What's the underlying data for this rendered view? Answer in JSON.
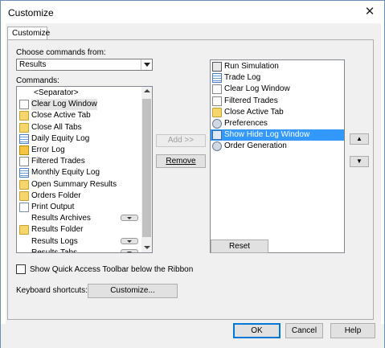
{
  "window": {
    "title": "Customize",
    "close_glyph": "✕"
  },
  "tab": {
    "label": "Customize"
  },
  "choose": {
    "label": "Choose commands from:",
    "value": "Results"
  },
  "commands": {
    "label": "Commands:",
    "items": [
      {
        "label": "<Separator>",
        "icon": "none"
      },
      {
        "label": "Clear Log Window",
        "icon": "clear-log-icon",
        "selected": true
      },
      {
        "label": "Close Active Tab",
        "icon": "folder-icon"
      },
      {
        "label": "Close All Tabs",
        "icon": "folder-icon"
      },
      {
        "label": "Daily Equity Log",
        "icon": "grid-icon"
      },
      {
        "label": "Error Log",
        "icon": "warning-icon"
      },
      {
        "label": "Filtered Trades",
        "icon": "filter-icon"
      },
      {
        "label": "Monthly Equity Log",
        "icon": "grid-icon"
      },
      {
        "label": "Open Summary Results",
        "icon": "open-icon"
      },
      {
        "label": "Orders Folder",
        "icon": "folder-icon"
      },
      {
        "label": "Print Output",
        "icon": "doc-icon"
      },
      {
        "label": "Results Archives",
        "icon": "none",
        "submenu": true
      },
      {
        "label": "Results Folder",
        "icon": "folder-icon"
      },
      {
        "label": "Results Logs",
        "icon": "none",
        "submenu": true
      },
      {
        "label": "Results Tabs",
        "icon": "none",
        "submenu": true
      }
    ]
  },
  "buttons": {
    "add": "Add >>",
    "remove": "Remove",
    "reset": "Reset",
    "move_up_glyph": "▲",
    "move_down_glyph": "▼",
    "customize": "Customize...",
    "ok": "OK",
    "cancel": "Cancel",
    "help": "Help"
  },
  "toolbar_items": [
    {
      "label": "Run Simulation",
      "icon": "play-icon"
    },
    {
      "label": "Trade Log",
      "icon": "grid-icon"
    },
    {
      "label": "Clear Log Window",
      "icon": "clear-log-icon"
    },
    {
      "label": "Filtered Trades",
      "icon": "filter-icon"
    },
    {
      "label": "Close Active Tab",
      "icon": "folder-icon"
    },
    {
      "label": "Preferences",
      "icon": "gear-icon"
    },
    {
      "label": "Show Hide Log Window",
      "icon": "window-icon",
      "highlighted": true
    },
    {
      "label": "Order Generation",
      "icon": "gear-icon"
    }
  ],
  "options": {
    "show_below_ribbon": "Show Quick Access Toolbar below the Ribbon",
    "checked": false
  },
  "keyboard": {
    "label": "Keyboard shortcuts:"
  },
  "colors": {
    "highlight": "#3399ff",
    "border": "#6b8fb8"
  }
}
